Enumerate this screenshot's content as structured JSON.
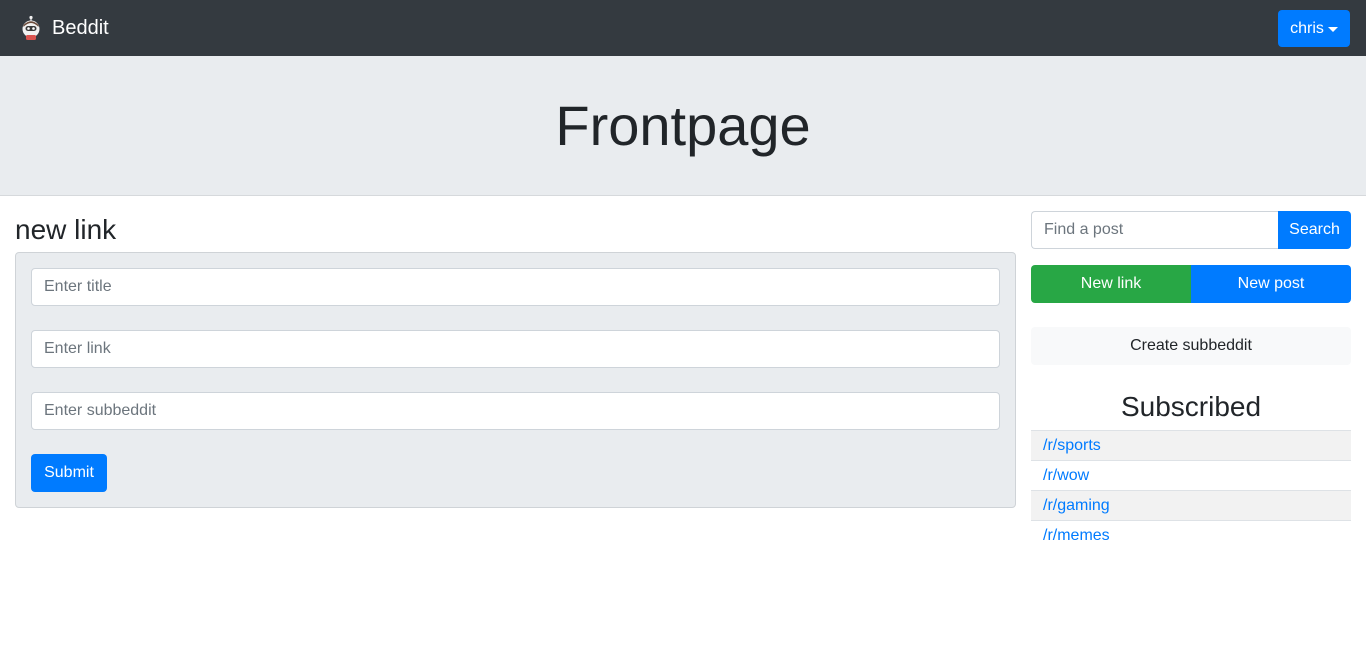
{
  "navbar": {
    "brand": "Beddit",
    "user": "chris"
  },
  "jumbotron": {
    "title": "Frontpage"
  },
  "form": {
    "heading": "new link",
    "title_placeholder": "Enter title",
    "link_placeholder": "Enter link",
    "subbeddit_placeholder": "Enter subbeddit",
    "submit_label": "Submit"
  },
  "sidebar": {
    "search_placeholder": "Find a post",
    "search_label": "Search",
    "new_link_label": "New link",
    "new_post_label": "New post",
    "create_label": "Create subbeddit",
    "subscribed_heading": "Subscribed",
    "subscriptions": [
      "/r/sports",
      "/r/wow",
      "/r/gaming",
      "/r/memes"
    ]
  },
  "colors": {
    "navbar": "#343a40",
    "primary": "#007bff",
    "success": "#28a745",
    "jumbotron": "#e9ecef"
  }
}
